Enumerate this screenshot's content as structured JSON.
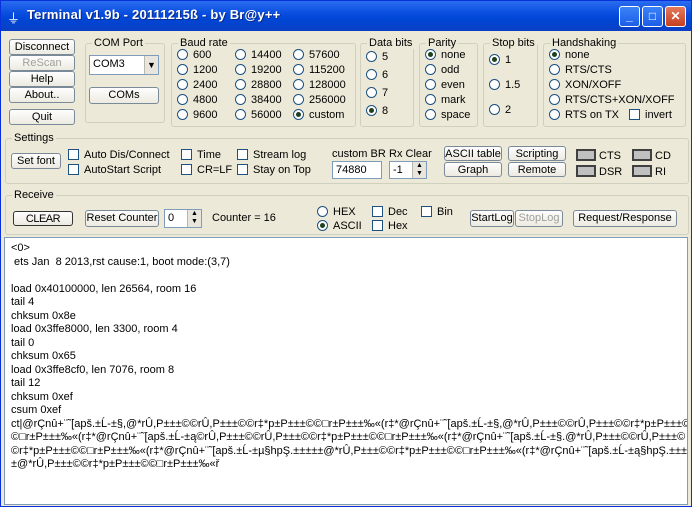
{
  "window": {
    "title": "Terminal v1.9b - 20111215ß - by Br@y++"
  },
  "titlebar_buttons": {
    "minimize": "_",
    "maximize": "□",
    "close": "✕"
  },
  "left_buttons": {
    "disconnect": "Disconnect",
    "rescan": "ReScan",
    "help": "Help",
    "about": "About..",
    "quit": "Quit"
  },
  "com_port": {
    "label": "COM Port",
    "selected": "COM3",
    "coms_button": "COMs"
  },
  "baud_rate": {
    "label": "Baud rate",
    "options": [
      "600",
      "1200",
      "2400",
      "4800",
      "9600",
      "14400",
      "19200",
      "28800",
      "38400",
      "56000",
      "57600",
      "115200",
      "128000",
      "256000",
      "custom"
    ],
    "selected": "custom"
  },
  "data_bits": {
    "label": "Data bits",
    "options": [
      "5",
      "6",
      "7",
      "8"
    ],
    "selected": "8"
  },
  "parity": {
    "label": "Parity",
    "options": [
      "none",
      "odd",
      "even",
      "mark",
      "space"
    ],
    "selected": "none"
  },
  "stop_bits": {
    "label": "Stop bits",
    "options": [
      "1",
      "1.5",
      "2"
    ],
    "selected": "1"
  },
  "handshaking": {
    "label": "Handshaking",
    "options": [
      "none",
      "RTS/CTS",
      "XON/XOFF",
      "RTS/CTS+XON/XOFF",
      "RTS on TX"
    ],
    "selected": "none",
    "invert_label": "invert"
  },
  "settings": {
    "label": "Settings",
    "set_font": "Set font",
    "auto_dis_connect": "Auto Dis/Connect",
    "autostart_script": "AutoStart Script",
    "time": "Time",
    "cr_lf": "CR=LF",
    "stream_log": "Stream log",
    "stay_on_top": "Stay on Top",
    "custom_br_label": "custom BR",
    "custom_br_value": "74880",
    "rx_clear_label": "Rx Clear",
    "rx_clear_value": "-1",
    "ascii_table": "ASCII table",
    "graph": "Graph",
    "scripting": "Scripting",
    "remote": "Remote",
    "cts": "CTS",
    "cd": "CD",
    "dsr": "DSR",
    "ri": "RI"
  },
  "receive": {
    "label": "Receive",
    "clear_button": "CLEAR",
    "reset_counter": "Reset Counter",
    "counter_spin_value": "0",
    "counter_label": "Counter = 16",
    "hex": "HEX",
    "ascii": "ASCII",
    "format_selected": "ASCII",
    "dec": "Dec",
    "hex_check": "Hex",
    "bin": "Bin",
    "start_log": "StartLog",
    "stop_log": "StopLog",
    "request_response": "Request/Response"
  },
  "terminal_lines": [
    "<0>",
    " ets Jan  8 2013,rst cause:1, boot mode:(3,7)",
    "",
    "load 0x40100000, len 26564, room 16",
    "tail 4",
    "chksum 0x8e",
    "load 0x3ffe8000, len 3300, room 4",
    "tail 0",
    "chksum 0x65",
    "load 0x3ffe8cf0, len 7076, room 8",
    "tail 12",
    "chksum 0xef",
    "csum 0xef",
    "ct|@rÇnû+¨˜[apš.±Ĺ-±§,@*rÛ,P±±±©©rÛ,P±±±©©r‡*p±P±±±©©□r±P±±±‰«(r‡*@rÇnû+¨˜[apš.±Ĺ-±§,@*rÛ,P±±±©©rÛ,P±±±©©r‡*p±P±±±©",
    "©□r±P±±±‰«(r‡*@rÇnû+¨˜[apš.±Ĺ-±ą©rÛ,P±±±©©rÛ,P±±±©©r‡*p±P±±±©©□r±P±±±‰«(r‡*@rÇnû+¨˜[apš.±Ĺ-±§.@*rÛ,P±±±©©rÛ,P±±±©",
    "©r‡*p±P±±±©©□r±P±±±‰«(r‡*@rÇnû+¨˜[apš.±Ĺ-±µ§hpŞ.±±±±±@*rÛ,P±±±©©r‡*p±P±±±©©□r±P±±±‰«(r‡*@rÇnû+¨˜[apš.±Ĺ-±ą§hpŞ.±±±±",
    "±@*rÛ,P±±±©©r‡*p±P±±±©©□r±P±±±‰«ř"
  ]
}
